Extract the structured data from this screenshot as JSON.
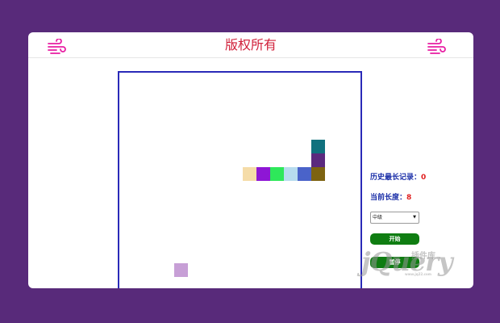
{
  "header": {
    "title": "版权所有",
    "icon_left": "wind-icon",
    "icon_right": "wind-icon",
    "title_color": "#d0203a",
    "icon_color": "#e81ea3"
  },
  "game": {
    "board_border_color": "#2a2ab8",
    "snake": [
      {
        "col": 14,
        "row": 5,
        "color": "#10717e"
      },
      {
        "col": 14,
        "row": 6,
        "color": "#5b2a7e"
      },
      {
        "col": 14,
        "row": 7,
        "color": "#7d6311"
      },
      {
        "col": 13,
        "row": 7,
        "color": "#4a63c9"
      },
      {
        "col": 12,
        "row": 7,
        "color": "#b7dcee"
      },
      {
        "col": 11,
        "row": 7,
        "color": "#2ee85a"
      },
      {
        "col": 10,
        "row": 7,
        "color": "#8e16d5"
      },
      {
        "col": 9,
        "row": 7,
        "color": "#f5dca8"
      }
    ],
    "food": {
      "col": 4,
      "row": 14,
      "color": "#c79fd6"
    }
  },
  "panel": {
    "record_label": "历史最长记录：",
    "record_value": "0",
    "length_label": "当前长度：",
    "length_value": "8",
    "difficulty_selected": "中级",
    "start_label": "开始",
    "pause_label": "暂停"
  },
  "watermark": {
    "main": "jQuery",
    "cn": "插件库",
    "sub": "www.jq22.com"
  }
}
